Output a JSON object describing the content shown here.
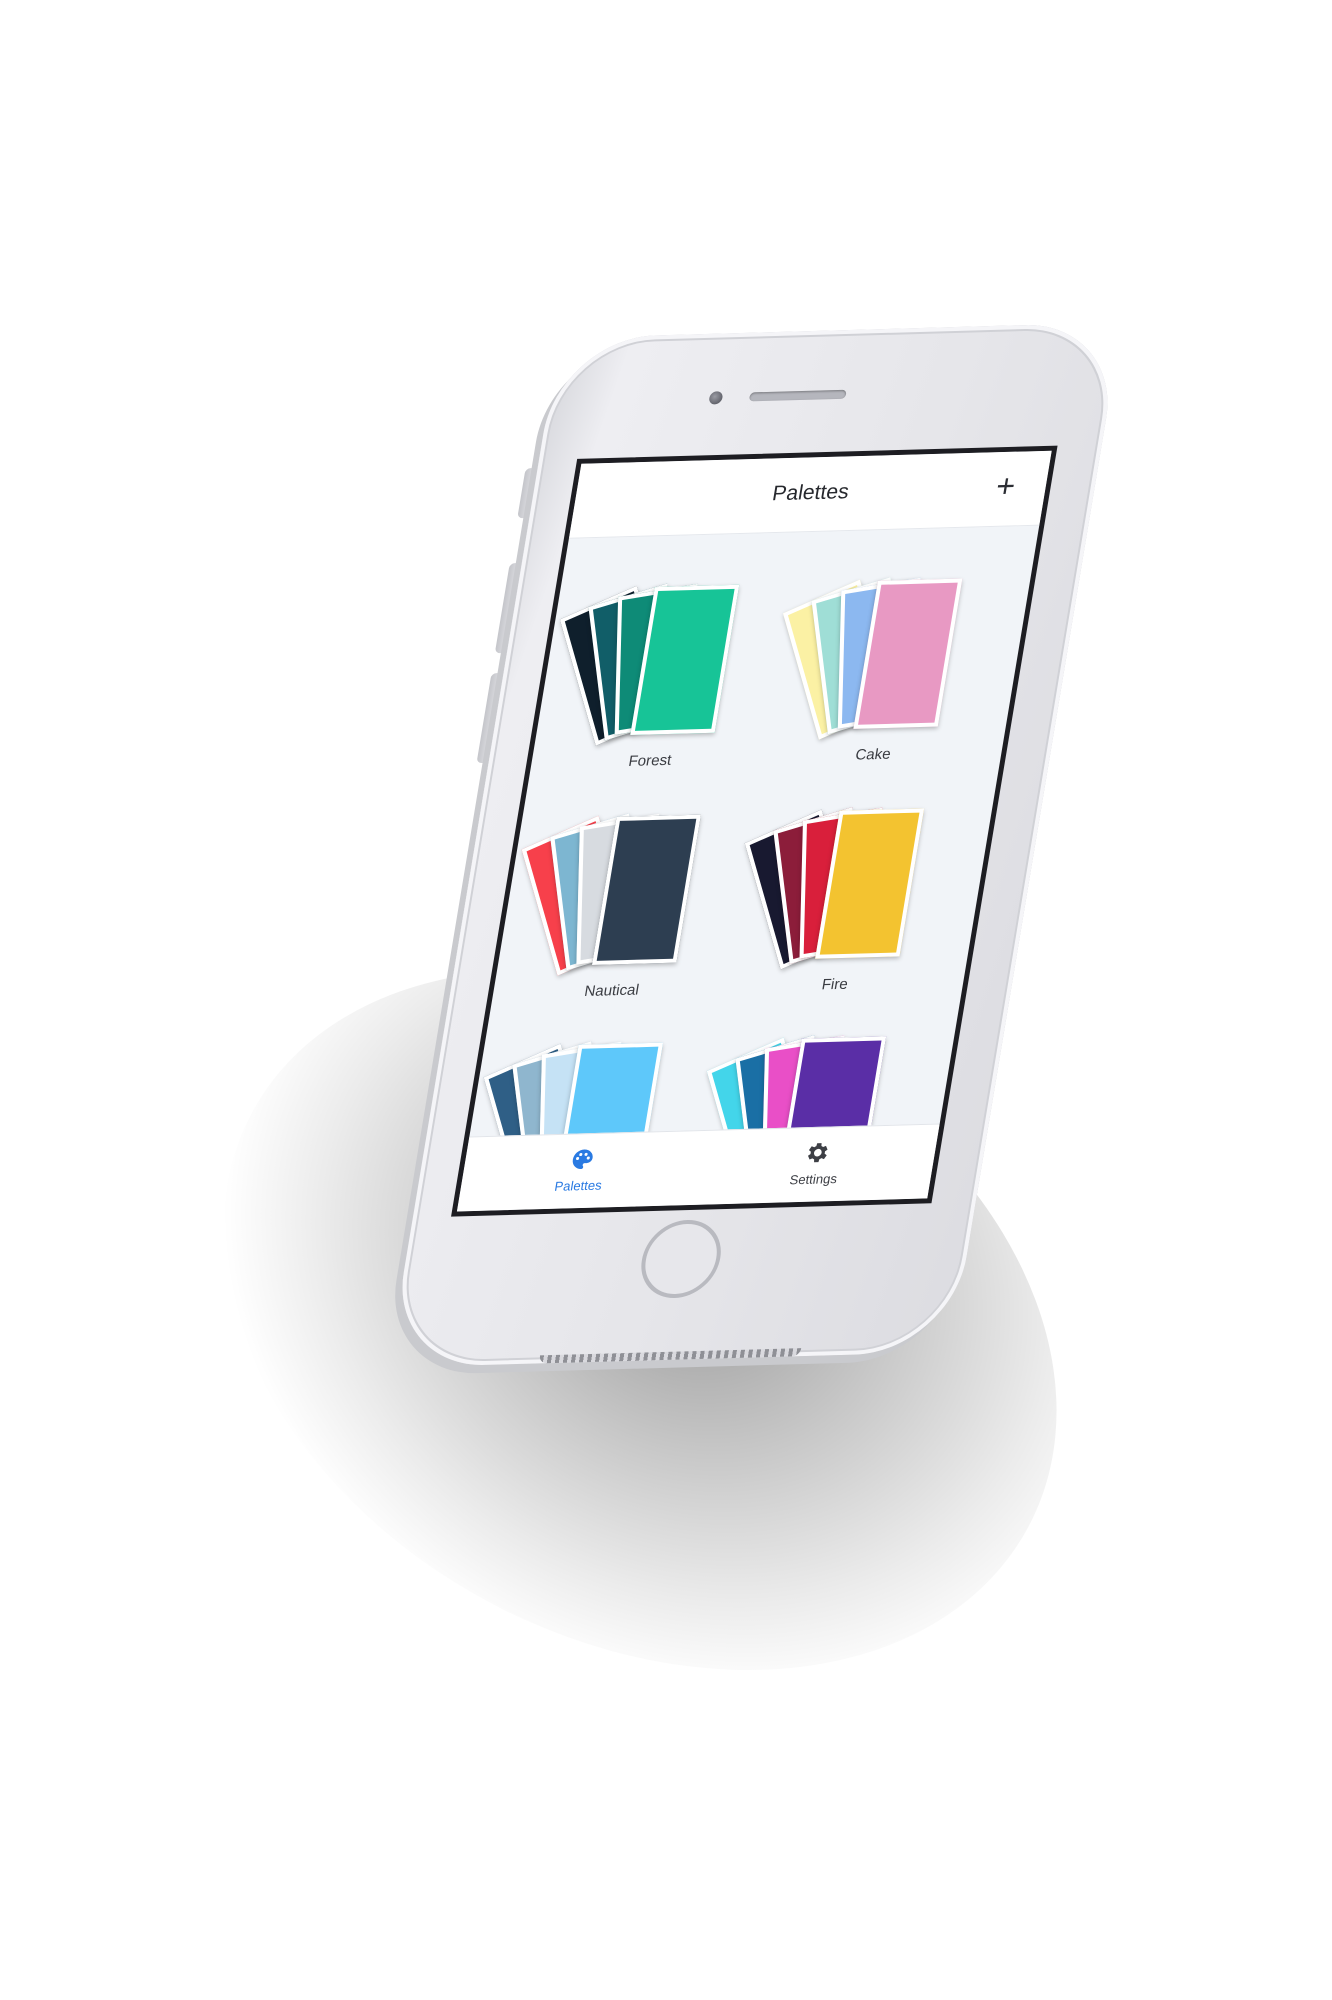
{
  "header": {
    "title": "Palettes",
    "add_label": "+"
  },
  "palettes": [
    {
      "name": "Forest",
      "colors": [
        "#0f1f2c",
        "#115e68",
        "#0e8b77",
        "#17c497"
      ]
    },
    {
      "name": "Cake",
      "colors": [
        "#fbf1a4",
        "#9fded6",
        "#8cb8f0",
        "#e899c3"
      ]
    },
    {
      "name": "Nautical",
      "colors": [
        "#f7404b",
        "#7db6d1",
        "#d7dbe0",
        "#2d3e51"
      ]
    },
    {
      "name": "Fire",
      "colors": [
        "#181930",
        "#8c1d3a",
        "#d91f3b",
        "#f3c330"
      ]
    },
    {
      "name": "",
      "colors": [
        "#2f5f86",
        "#8fb6ce",
        "#c5e2f5",
        "#5ec8fa"
      ]
    },
    {
      "name": "",
      "colors": [
        "#43d5ea",
        "#1a6fa5",
        "#e94fc7",
        "#5a2ea6"
      ]
    }
  ],
  "tabs": [
    {
      "label": "Palettes",
      "icon": "palette-icon",
      "active": true
    },
    {
      "label": "Settings",
      "icon": "gear-icon",
      "active": false
    }
  ],
  "colors": {
    "accent": "#2a7ae2",
    "screen_bg": "#f1f4f8"
  }
}
